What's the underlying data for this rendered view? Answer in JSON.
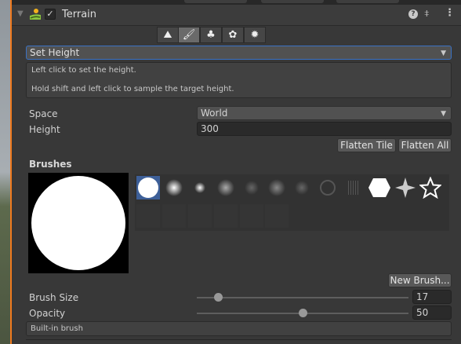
{
  "component": {
    "title": "Terrain",
    "enabled": true,
    "icons": [
      "help-icon",
      "preset-icon",
      "more-icon"
    ]
  },
  "toolbar": {
    "tools": [
      "raise-terrain-icon",
      "paint-brush-icon",
      "trees-icon",
      "details-icon",
      "settings-icon"
    ],
    "selected": 1
  },
  "tool_dropdown": {
    "value": "Set Height"
  },
  "help": {
    "line1": "Left click to set the height.",
    "line2": "Hold shift and left click to sample the target height."
  },
  "space": {
    "label": "Space",
    "value": "World"
  },
  "height": {
    "label": "Height",
    "value": "300"
  },
  "buttons": {
    "flatten_tile": "Flatten Tile",
    "flatten_all": "Flatten All",
    "new_brush": "New Brush..."
  },
  "brushes": {
    "label": "Brushes",
    "selected": 0
  },
  "brush_size": {
    "label": "Brush Size",
    "value": "17"
  },
  "opacity": {
    "label": "Opacity",
    "value": "50"
  },
  "brush_description": "Built-in brush",
  "colors": {
    "accent": "#3a72c4",
    "selection": "#3d5f98",
    "panel": "#383838"
  }
}
